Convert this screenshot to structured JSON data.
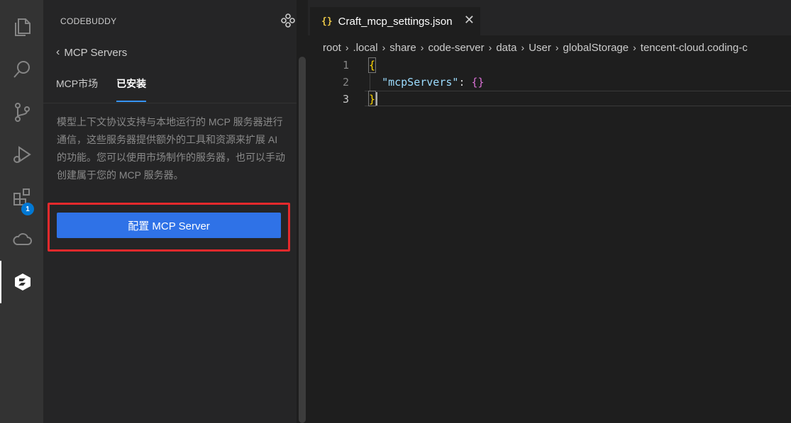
{
  "sidebar": {
    "title": "CODEBUDDY",
    "back_label": "MCP Servers",
    "tabs": [
      {
        "label": "MCP市场",
        "active": false
      },
      {
        "label": "已安装",
        "active": true
      }
    ],
    "description": "模型上下文协议支持与本地运行的 MCP 服务器进行通信，这些服务器提供额外的工具和资源来扩展 AI 的功能。您可以使用市场制作的服务器，也可以手动创建属于您的 MCP 服务器。",
    "config_button_label": "配置 MCP Server"
  },
  "activity_bar": {
    "items": [
      {
        "icon": "files-icon"
      },
      {
        "icon": "search-icon"
      },
      {
        "icon": "source-control-icon"
      },
      {
        "icon": "run-debug-icon"
      },
      {
        "icon": "extensions-icon",
        "badge": "1"
      },
      {
        "icon": "cloud-icon"
      },
      {
        "icon": "codebuddy-icon",
        "active": true
      }
    ]
  },
  "editor": {
    "tab_icon": "{}",
    "tab_title": "Craft_mcp_settings.json",
    "breadcrumb": [
      "root",
      ".local",
      "share",
      "code-server",
      "data",
      "User",
      "globalStorage",
      "tencent-cloud.coding-c"
    ],
    "line_numbers": [
      "1",
      "2",
      "3"
    ],
    "code": {
      "open_brace": "{",
      "key": "\"mcpServers\"",
      "colon": ": ",
      "value": "{}",
      "close_brace": "}"
    }
  },
  "colors": {
    "accent_button": "#2f72e7",
    "highlight_box": "#e5292c",
    "active_tab_underline": "#3794ff"
  }
}
